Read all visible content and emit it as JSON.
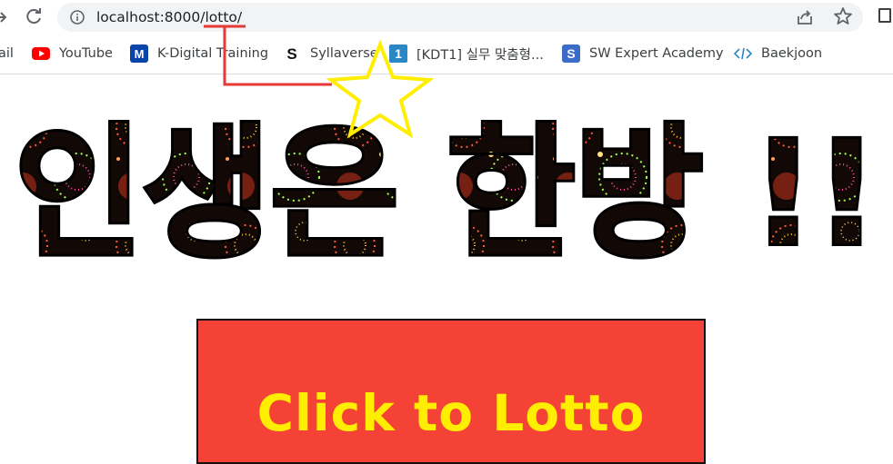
{
  "browser": {
    "url_host": "localhost:8000",
    "url_path": "/lotto/",
    "bookmarks": [
      {
        "label": "ail",
        "icon": "gmail-icon"
      },
      {
        "label": "YouTube",
        "icon": "youtube-icon"
      },
      {
        "label": "K-Digital Training",
        "icon": "k-digital-m-icon"
      },
      {
        "label": "Syllaverse",
        "icon": "syllaverse-s-icon"
      },
      {
        "label": "[KDT1] 실무 맞춤형...",
        "icon": "kdt-number-icon"
      },
      {
        "label": "SW Expert Academy",
        "icon": "sw-expert-icon"
      },
      {
        "label": "Baekjoon",
        "icon": "code-brackets-icon"
      }
    ]
  },
  "page": {
    "headline": "인생은 한방 !!",
    "button_label": "Click to Lotto"
  },
  "colors": {
    "button_bg": "#f44336",
    "button_text": "#ffee00",
    "annotation_red": "#e53935",
    "annotation_star": "#ffee00"
  }
}
